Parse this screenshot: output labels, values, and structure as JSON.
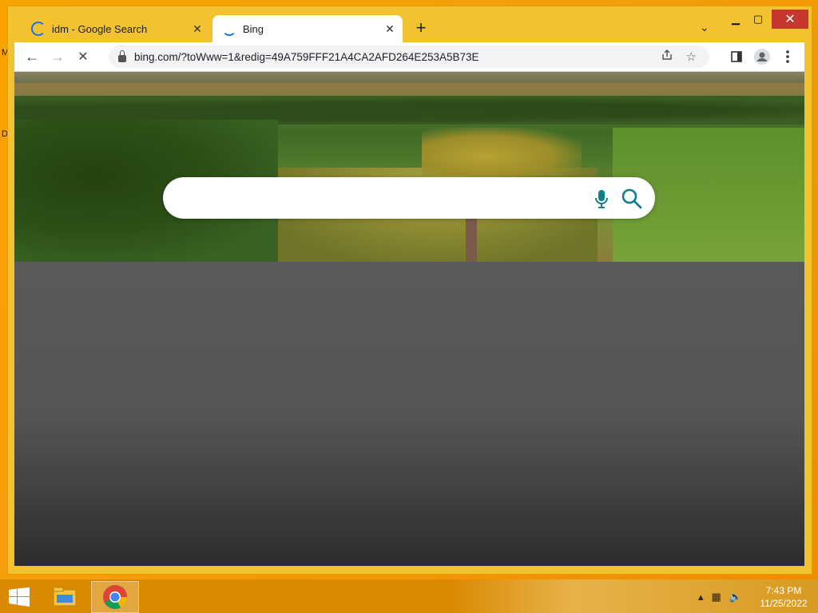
{
  "desktop": {
    "left_edge_letters": [
      "M",
      "D"
    ]
  },
  "tabs": [
    {
      "label": "idm - Google Search",
      "active": false
    },
    {
      "label": "Bing",
      "active": true
    }
  ],
  "tabstrip": {
    "new_tab": "+",
    "tab_search": "⌄"
  },
  "window_controls": {
    "minimize": "▁",
    "maximize": "▢",
    "close": "✕"
  },
  "toolbar": {
    "back": "←",
    "forward": "→",
    "stop": "✕"
  },
  "omnibox": {
    "url": "bing.com/?toWww=1&redig=49A759FFF21A4CA2AFD264E253A5B73E"
  },
  "search": {
    "query": "",
    "placeholder": ""
  },
  "taskbar": {
    "time": "7:43 PM",
    "date": "11/25/2022"
  }
}
